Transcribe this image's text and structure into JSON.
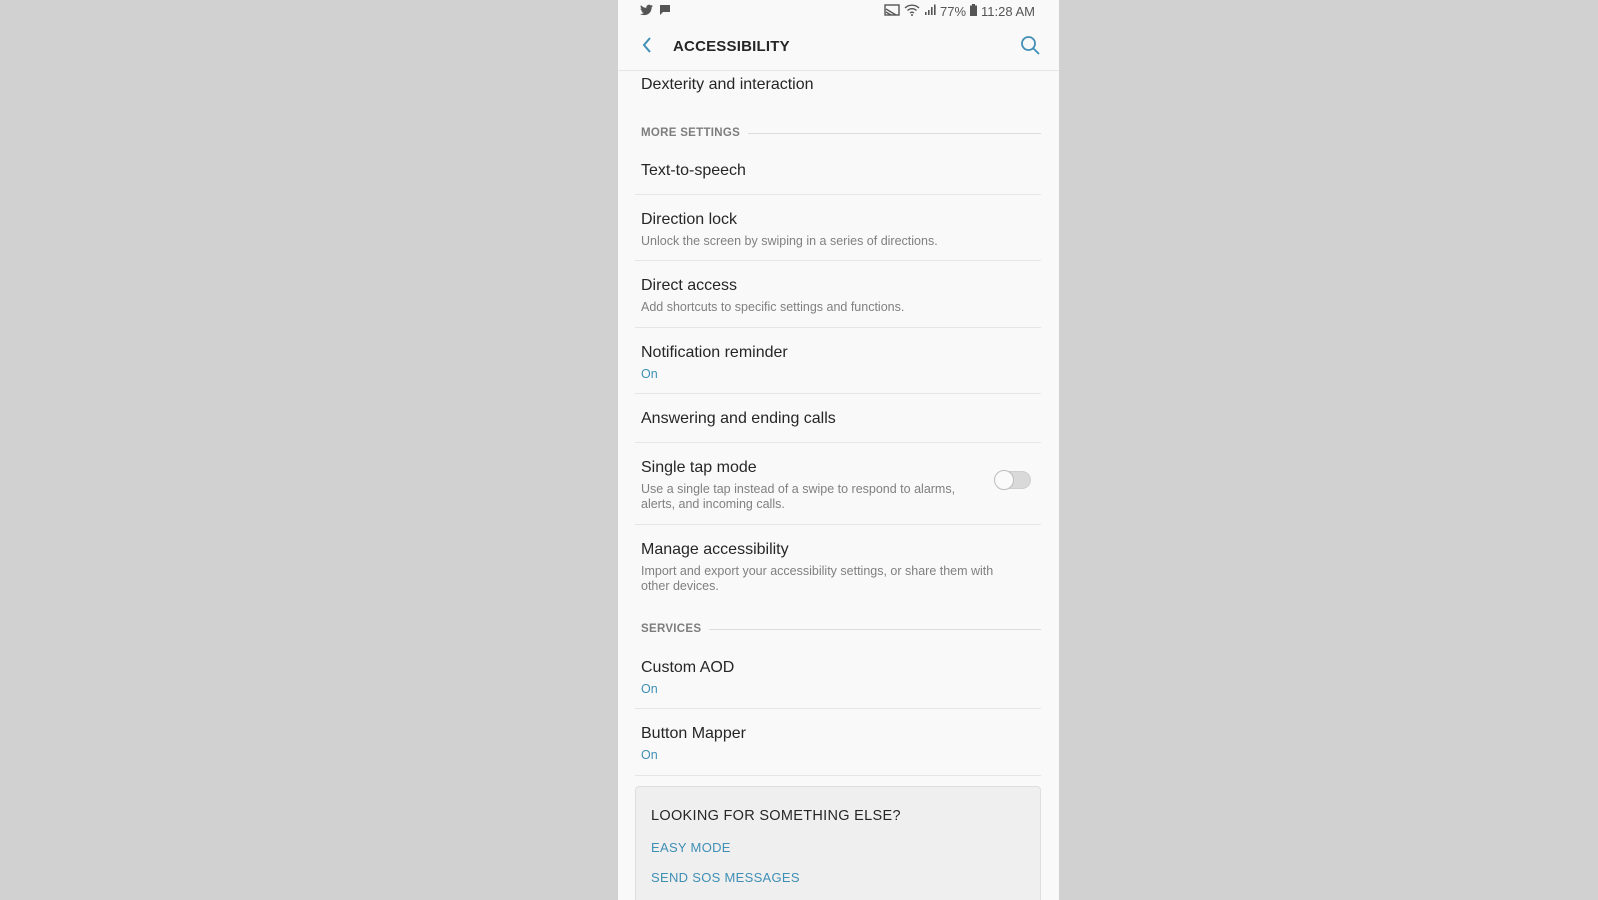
{
  "status_bar": {
    "left_icons": [
      "twitter-icon",
      "message-icon"
    ],
    "right_icons": [
      "cast-icon",
      "wifi-icon",
      "signal-icon",
      "battery-icon"
    ],
    "battery": "77%",
    "time": "11:28 AM"
  },
  "app_bar": {
    "title": "ACCESSIBILITY",
    "back_icon": "chevron-left-icon",
    "search_icon": "search-icon"
  },
  "colors": {
    "accent": "#3f8fb5",
    "background": "#f9f9f9",
    "outer_background": "#d1d1d1"
  },
  "items": {
    "dexterity": {
      "title": "Dexterity and interaction"
    },
    "tts": {
      "title": "Text-to-speech"
    },
    "direction_lock": {
      "title": "Direction lock",
      "subtitle": "Unlock the screen by swiping in a series of directions."
    },
    "direct_access": {
      "title": "Direct access",
      "subtitle": "Add shortcuts to specific settings and functions."
    },
    "notification_reminder": {
      "title": "Notification reminder",
      "status": "On"
    },
    "answering_calls": {
      "title": "Answering and ending calls"
    },
    "single_tap": {
      "title": "Single tap mode",
      "subtitle_line1": "Use a single tap instead of a swipe to respond to alarms,",
      "subtitle_line2": "alerts, and incoming calls.",
      "enabled": false
    },
    "manage_accessibility": {
      "title": "Manage accessibility",
      "subtitle_line1": "Import and export your accessibility settings, or share them with",
      "subtitle_line2": "other devices."
    },
    "custom_aod": {
      "title": "Custom AOD",
      "status": "On"
    },
    "button_mapper": {
      "title": "Button Mapper",
      "status": "On"
    }
  },
  "sections": {
    "more_settings": "MORE SETTINGS",
    "services": "SERVICES"
  },
  "card": {
    "title": "LOOKING FOR SOMETHING ELSE?",
    "links": [
      "EASY MODE",
      "SEND SOS MESSAGES"
    ]
  }
}
